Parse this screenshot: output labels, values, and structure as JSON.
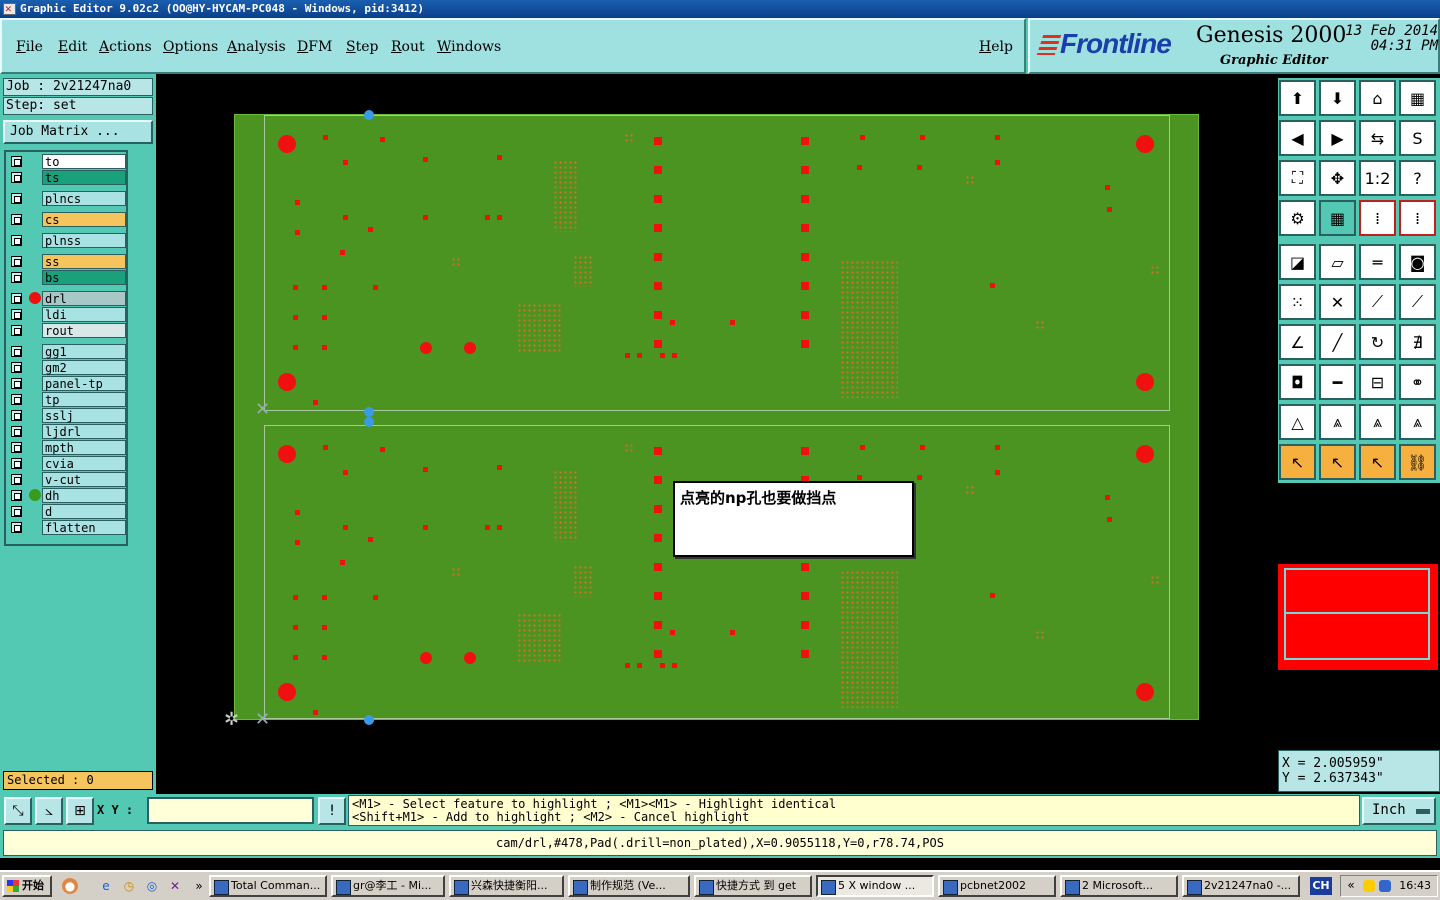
{
  "window": {
    "title": "Graphic Editor 9.02c2 (OO@HY-HYCAM-PC048 - Windows, pid:3412)"
  },
  "menu": {
    "file": "File",
    "edit": "Edit",
    "actions": "Actions",
    "options": "Options",
    "analysis": "Analysis",
    "dfm": "DFM",
    "step": "Step",
    "rout": "Rout",
    "windows": "Windows",
    "help": "Help"
  },
  "brand": {
    "logo": "Frontline",
    "product": "Genesis 2000",
    "subtitle": "Graphic Editor",
    "date": "13 Feb 2014",
    "time": "04:31 PM"
  },
  "job": {
    "job_line": "Job : 2v21247na0",
    "step_line": "Step: set",
    "job_matrix": "Job Matrix ..."
  },
  "layers": [
    {
      "name": "to",
      "color": "#ffffff",
      "dot": ""
    },
    {
      "name": "ts",
      "color": "#1aa07a",
      "dot": ""
    },
    {
      "name": "plncs",
      "color": "#a8e2e2",
      "dot": ""
    },
    {
      "name": "cs",
      "color": "#f6c45c",
      "dot": ""
    },
    {
      "name": "plnss",
      "color": "#a8e2e2",
      "dot": ""
    },
    {
      "name": "ss",
      "color": "#f6c45c",
      "dot": ""
    },
    {
      "name": "bs",
      "color": "#1aa07a",
      "dot": ""
    },
    {
      "name": "drl",
      "color": "#a8c8c8",
      "dot": "#ee1010"
    },
    {
      "name": "ldi",
      "color": "#a8e2e2",
      "dot": ""
    },
    {
      "name": "rout",
      "color": "#d8e8e8",
      "dot": ""
    },
    {
      "name": "gg1",
      "color": "#a8e2e2",
      "dot": ""
    },
    {
      "name": "gm2",
      "color": "#a8e2e2",
      "dot": ""
    },
    {
      "name": "panel-tp",
      "color": "#a8e2e2",
      "dot": ""
    },
    {
      "name": "tp",
      "color": "#a8e2e2",
      "dot": ""
    },
    {
      "name": "sslj",
      "color": "#a8e2e2",
      "dot": ""
    },
    {
      "name": "ljdrl",
      "color": "#a8e2e2",
      "dot": ""
    },
    {
      "name": "mpth",
      "color": "#a8e2e2",
      "dot": ""
    },
    {
      "name": "cvia",
      "color": "#a8e2e2",
      "dot": ""
    },
    {
      "name": "v-cut",
      "color": "#a8e2e2",
      "dot": ""
    },
    {
      "name": "dh",
      "color": "#a8e2e2",
      "dot": "#3a9a20"
    },
    {
      "name": "d",
      "color": "#a8e2e2",
      "dot": ""
    },
    {
      "name": "flatten",
      "color": "#a8e2e2",
      "dot": ""
    }
  ],
  "selected": "Selected : 0",
  "annotation": "点亮的np孔也要做挡点",
  "coords": {
    "x": "X = 2.005959\"",
    "y": "Y = 2.637343\""
  },
  "bottom": {
    "xy_label": "X Y :",
    "xy_value": "",
    "hint_line1": "<M1> - Select feature to highlight ; <M1><M1> - Highlight identical",
    "hint_line2": "<Shift+M1> - Add to highlight ; <M2> - Cancel highlight",
    "units": "Inch",
    "status": "cam/drl,#478,Pad(.drill=non_plated),X=0.9055118,Y=0,r78.74,POS"
  },
  "taskbar": {
    "start": "开始",
    "tasks": [
      "Total Comman...",
      "gr@李工 - Mi...",
      "兴森快捷衡阳...",
      "制作规范 (Ve...",
      "快捷方式 到 get",
      "5 X window ...",
      "pcbnet2002",
      "2 Microsoft...",
      "2v21247na0 -..."
    ],
    "lang": "CH",
    "clock": "16:43"
  },
  "tools": [
    "home-up-icon",
    "home-down-icon",
    "house-icon",
    "window-icon",
    "arrow-left-icon",
    "arrow-right-icon",
    "swap-icon",
    "s-curve-icon",
    "fit-icon",
    "center-icon",
    "ratio-icon",
    "help-icon",
    "settings-icon",
    "grid-icon",
    "layers-a-icon",
    "layers-b-icon",
    "measure-icon",
    "parallelogram-icon",
    "ruler-icon",
    "frame-icon",
    "nodes-icon",
    "x-node-icon",
    "line-node-icon",
    "line-node2-icon",
    "angle-icon",
    "slash-icon",
    "arc-icon",
    "ff-icon",
    "shape-dot-icon",
    "minus-icon",
    "dimension-icon",
    "circles-icon",
    "triangle-a-icon",
    "triangle-b-icon",
    "triangle-c-icon",
    "triangle-d-icon",
    "pointer-icon",
    "pointer-box-icon",
    "pointer-sel-icon",
    "route-icon"
  ],
  "tool_symbols": [
    "⬆",
    "⬇",
    "⌂",
    "▦",
    "◀",
    "▶",
    "⇆",
    "S",
    "⛶",
    "✥",
    "1:2",
    "?",
    "⚙",
    "▦",
    "⁞",
    "⁞",
    "◪",
    "▱",
    "═",
    "◙",
    "⁙",
    "✕",
    "⟋",
    "⟋",
    "∠",
    "╱",
    "↻",
    "∄",
    "◘",
    "━",
    "⊟",
    "⚭",
    "△",
    "⩓",
    "⩓",
    "⩓",
    "↖",
    "↖",
    "↖",
    "⛓"
  ]
}
